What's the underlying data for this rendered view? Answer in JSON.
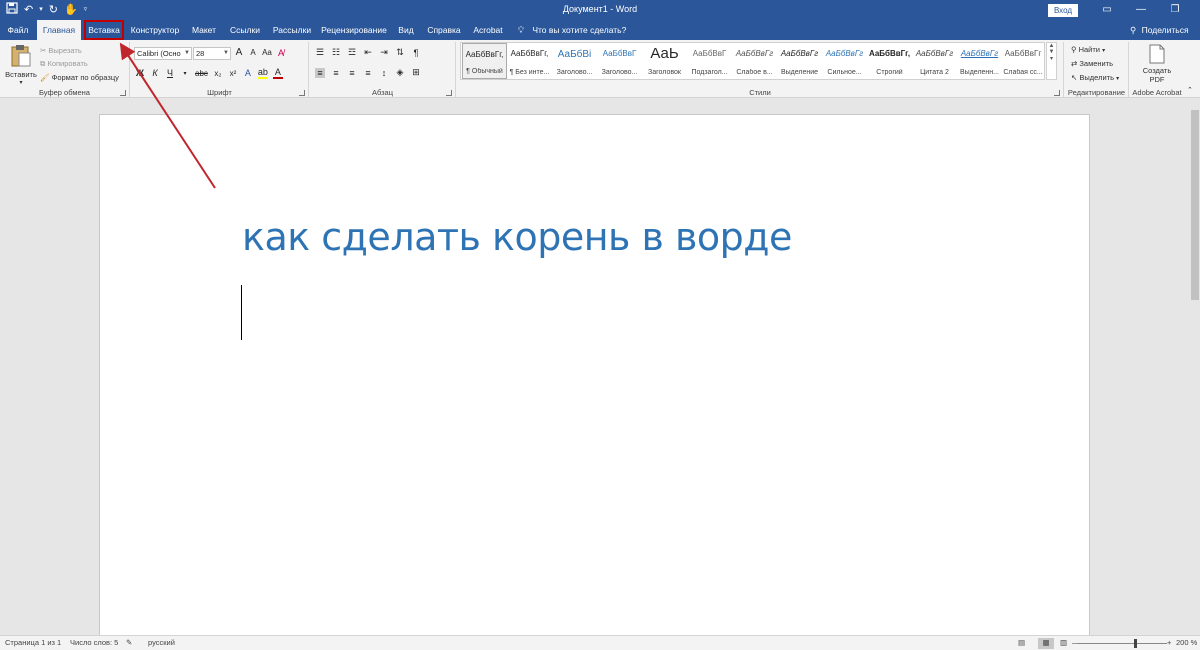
{
  "titlebar": {
    "title": "Документ1 - Word",
    "signin": "Вход",
    "qat_icons": [
      "save-icon",
      "undo-icon",
      "redo-icon",
      "touch-mode-icon",
      "customize-qat-icon"
    ],
    "minimize": "—",
    "restore": "❐",
    "close": "✕"
  },
  "tabs": {
    "items": [
      "Файл",
      "Главная",
      "Вставка",
      "Конструктор",
      "Макет",
      "Ссылки",
      "Рассылки",
      "Рецензирование",
      "Вид",
      "Справка",
      "Acrobat"
    ],
    "active": "Главная",
    "highlighted": "Вставка",
    "tell_me": "Что вы хотите сделать?",
    "share": "Поделиться"
  },
  "ribbon": {
    "clipboard": {
      "paste": "Вставить",
      "cut": "Вырезать",
      "copy": "Копировать",
      "format_painter": "Формат по образцу",
      "label": "Буфер обмена"
    },
    "font": {
      "font_name": "Calibri (Осно",
      "font_size": "28",
      "label": "Шрифт",
      "bold": "Ж",
      "italic": "К",
      "underline": "Ч",
      "strike": "abc",
      "subscript": "x₂",
      "superscript": "x²",
      "grow": "A",
      "shrink": "A",
      "case": "Aa",
      "clear": "A"
    },
    "paragraph": {
      "label": "Абзац",
      "pilcrow": "¶"
    },
    "styles": {
      "label": "Стили",
      "items": [
        {
          "sample": "АаБбВвГг,",
          "name": "¶ Обычный"
        },
        {
          "sample": "АаБбВвГг,",
          "name": "¶ Без инте..."
        },
        {
          "sample": "АаБбВі",
          "name": "Заголово..."
        },
        {
          "sample": "АаБбВвГ",
          "name": "Заголово..."
        },
        {
          "sample": "АаЬ",
          "name": "Заголовок"
        },
        {
          "sample": "АаБбВвГ",
          "name": "Подзагол..."
        },
        {
          "sample": "АаБбВвГг",
          "name": "Слабое в..."
        },
        {
          "sample": "АаБбВвГг",
          "name": "Выделение"
        },
        {
          "sample": "АаБбВвГг",
          "name": "Сильное..."
        },
        {
          "sample": "АаБбВвГг,",
          "name": "Строгий"
        },
        {
          "sample": "АаБбВвГг",
          "name": "Цитата 2"
        },
        {
          "sample": "АаБбВвГг",
          "name": "Выделенн..."
        },
        {
          "sample": "АаБбВвГг",
          "name": "Слабая сс..."
        }
      ]
    },
    "editing": {
      "find": "Найти",
      "replace": "Заменить",
      "select": "Выделить",
      "label": "Редактирование"
    },
    "acrobat": {
      "create_pdf_line1": "Создать",
      "create_pdf_line2": "PDF",
      "label": "Adobe Acrobat"
    }
  },
  "document": {
    "heading": "как сделать корень в ворде",
    "heading_color": "#2e74b5"
  },
  "statusbar": {
    "page": "Страница 1 из 1",
    "words": "Число слов: 5",
    "language": "русский",
    "zoom": "200 %",
    "zoom_minus": "—",
    "zoom_plus": "+"
  },
  "colors": {
    "brand": "#2b579a",
    "highlight_box": "#c00000",
    "arrow": "#c0272d"
  }
}
